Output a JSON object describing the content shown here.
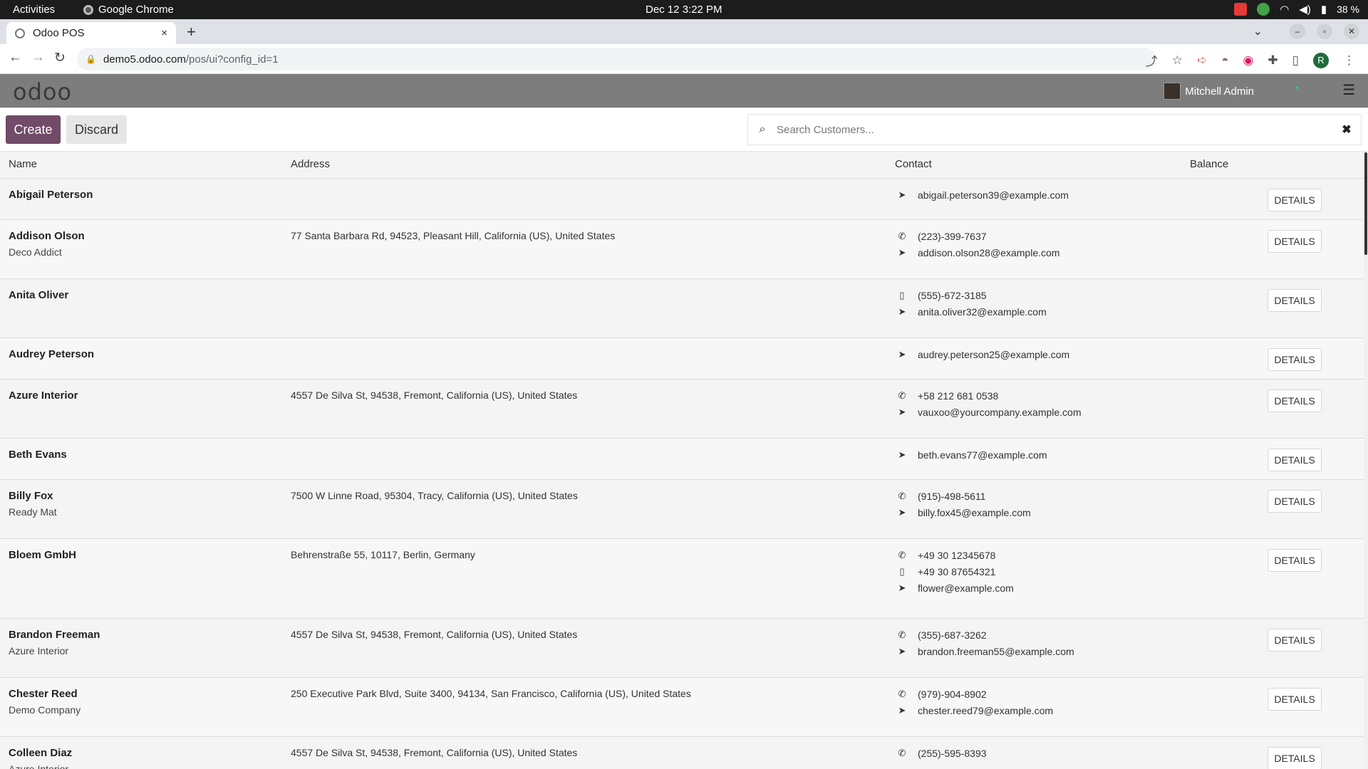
{
  "system_bar": {
    "activities": "Activities",
    "app_name": "Google Chrome",
    "clock": "Dec 12  3:22 PM",
    "battery": "38 %"
  },
  "browser": {
    "tab_title": "Odoo POS",
    "tab_close": "×",
    "new_tab": "+",
    "url_host": "demo5.odoo.com",
    "url_path": "/pos/ui?config_id=1",
    "profile_initial": "R"
  },
  "odoo": {
    "logo": "odoo",
    "user_name": "Mitchell Admin"
  },
  "controls": {
    "create_label": "Create",
    "discard_label": "Discard",
    "search_placeholder": "Search Customers...",
    "clear_icon": "✖"
  },
  "table": {
    "headers": {
      "name": "Name",
      "address": "Address",
      "contact": "Contact",
      "balance": "Balance"
    },
    "details_label": "DETAILS",
    "rows": [
      {
        "name": "Abigail Peterson",
        "company": "",
        "address": "",
        "contacts": [
          {
            "type": "email",
            "value": "abigail.peterson39@example.com"
          }
        ]
      },
      {
        "name": "Addison Olson",
        "company": "Deco Addict",
        "address": "77 Santa Barbara Rd, 94523, Pleasant Hill, California (US), United States",
        "contacts": [
          {
            "type": "phone",
            "value": "(223)-399-7637"
          },
          {
            "type": "email",
            "value": "addison.olson28@example.com"
          }
        ]
      },
      {
        "name": "Anita Oliver",
        "company": "",
        "address": "",
        "contacts": [
          {
            "type": "mobile",
            "value": "(555)-672-3185"
          },
          {
            "type": "email",
            "value": "anita.oliver32@example.com"
          }
        ]
      },
      {
        "name": "Audrey Peterson",
        "company": "",
        "address": "",
        "contacts": [
          {
            "type": "email",
            "value": "audrey.peterson25@example.com"
          }
        ]
      },
      {
        "name": "Azure Interior",
        "company": "",
        "address": "4557 De Silva St, 94538, Fremont, California (US), United States",
        "contacts": [
          {
            "type": "phone",
            "value": "+58 212 681 0538"
          },
          {
            "type": "email",
            "value": "vauxoo@yourcompany.example.com"
          }
        ]
      },
      {
        "name": "Beth Evans",
        "company": "",
        "address": "",
        "contacts": [
          {
            "type": "email",
            "value": "beth.evans77@example.com"
          }
        ]
      },
      {
        "name": "Billy Fox",
        "company": "Ready Mat",
        "address": "7500 W Linne Road, 95304, Tracy, California (US), United States",
        "contacts": [
          {
            "type": "phone",
            "value": "(915)-498-5611"
          },
          {
            "type": "email",
            "value": "billy.fox45@example.com"
          }
        ]
      },
      {
        "name": "Bloem GmbH",
        "company": "",
        "address": "Behrenstraße 55, 10117, Berlin, Germany",
        "contacts": [
          {
            "type": "phone",
            "value": "+49 30 12345678"
          },
          {
            "type": "mobile",
            "value": "+49 30 87654321"
          },
          {
            "type": "email",
            "value": "flower@example.com"
          }
        ]
      },
      {
        "name": "Brandon Freeman",
        "company": "Azure Interior",
        "address": "4557 De Silva St, 94538, Fremont, California (US), United States",
        "contacts": [
          {
            "type": "phone",
            "value": "(355)-687-3262"
          },
          {
            "type": "email",
            "value": "brandon.freeman55@example.com"
          }
        ]
      },
      {
        "name": "Chester Reed",
        "company": "Demo Company",
        "address": "250 Executive Park Blvd, Suite 3400, 94134, San Francisco, California (US), United States",
        "contacts": [
          {
            "type": "phone",
            "value": "(979)-904-8902"
          },
          {
            "type": "email",
            "value": "chester.reed79@example.com"
          }
        ]
      },
      {
        "name": "Colleen Diaz",
        "company": "Azure Interior",
        "address": "4557 De Silva St, 94538, Fremont, California (US), United States",
        "contacts": [
          {
            "type": "phone",
            "value": "(255)-595-8393"
          }
        ]
      }
    ]
  },
  "colors": {
    "brand": "#714b67",
    "header_bg": "#7d7d7d"
  }
}
